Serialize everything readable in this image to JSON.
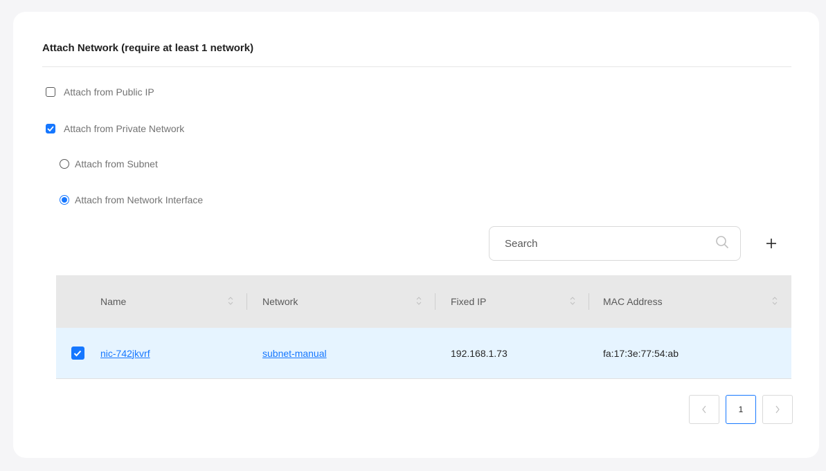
{
  "section": {
    "title": "Attach Network (require at least 1 network)"
  },
  "options": {
    "public_ip": {
      "label": "Attach from Public IP",
      "checked": false
    },
    "private_network": {
      "label": "Attach from Private Network",
      "checked": true
    },
    "subnet": {
      "label": "Attach from Subnet",
      "selected": false
    },
    "network_interface": {
      "label": "Attach from Network Interface",
      "selected": true
    }
  },
  "search": {
    "placeholder": "Search",
    "value": "",
    "icon": "search-icon"
  },
  "add_button": {
    "icon": "plus-icon"
  },
  "table": {
    "columns": [
      "Name",
      "Network",
      "Fixed IP",
      "MAC Address"
    ],
    "rows": [
      {
        "selected": true,
        "name": "nic-742jkvrf",
        "network": "subnet-manual",
        "fixed_ip": "192.168.1.73",
        "mac_address": "fa:17:3e:77:54:ab"
      }
    ]
  },
  "pagination": {
    "prev": "<",
    "current": "1",
    "next": ">"
  },
  "colors": {
    "accent": "#1677ff",
    "row_selected_bg": "#e6f4ff",
    "header_bg": "#e8e8e8"
  }
}
